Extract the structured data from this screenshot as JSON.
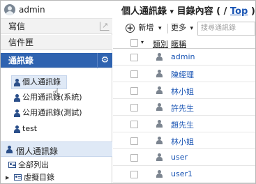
{
  "user": {
    "name": "admin"
  },
  "sidebar": {
    "nav": [
      {
        "label": "寫信"
      },
      {
        "label": "信件匣"
      },
      {
        "label": "通訊錄"
      }
    ],
    "address_books": [
      {
        "label": "個人通訊錄",
        "selected": true
      },
      {
        "label": "公用通訊錄(系統)"
      },
      {
        "label": "公用通訊錄(測試)"
      },
      {
        "label": "test"
      }
    ],
    "section": {
      "label": "個人通訊錄"
    },
    "folders": [
      {
        "label": "全部列出"
      },
      {
        "label": "虛擬目錄"
      }
    ]
  },
  "main": {
    "title": {
      "book": "個人通訊錄",
      "dropdown": "▾",
      "contents": "目錄內容",
      "open_paren": "(",
      "slash": "/",
      "top_link": "Top",
      "close_paren": ")"
    },
    "toolbar": {
      "new_label": "新增",
      "more_label": "更多",
      "caret": "▾",
      "search_placeholder": "搜尋通訊錄"
    },
    "table": {
      "columns": [
        {
          "label": "類別"
        },
        {
          "label": "暱稱"
        }
      ],
      "rows": [
        {
          "name": "admin"
        },
        {
          "name": "陳經理"
        },
        {
          "name": "林小姐"
        },
        {
          "name": "許先生"
        },
        {
          "name": "趙先生"
        },
        {
          "name": "林小姐"
        },
        {
          "name": "user"
        },
        {
          "name": "user1"
        }
      ]
    }
  },
  "colors": {
    "accent": "#2f63b0",
    "link": "#1a55b4",
    "selection": "#dfe9f6"
  }
}
